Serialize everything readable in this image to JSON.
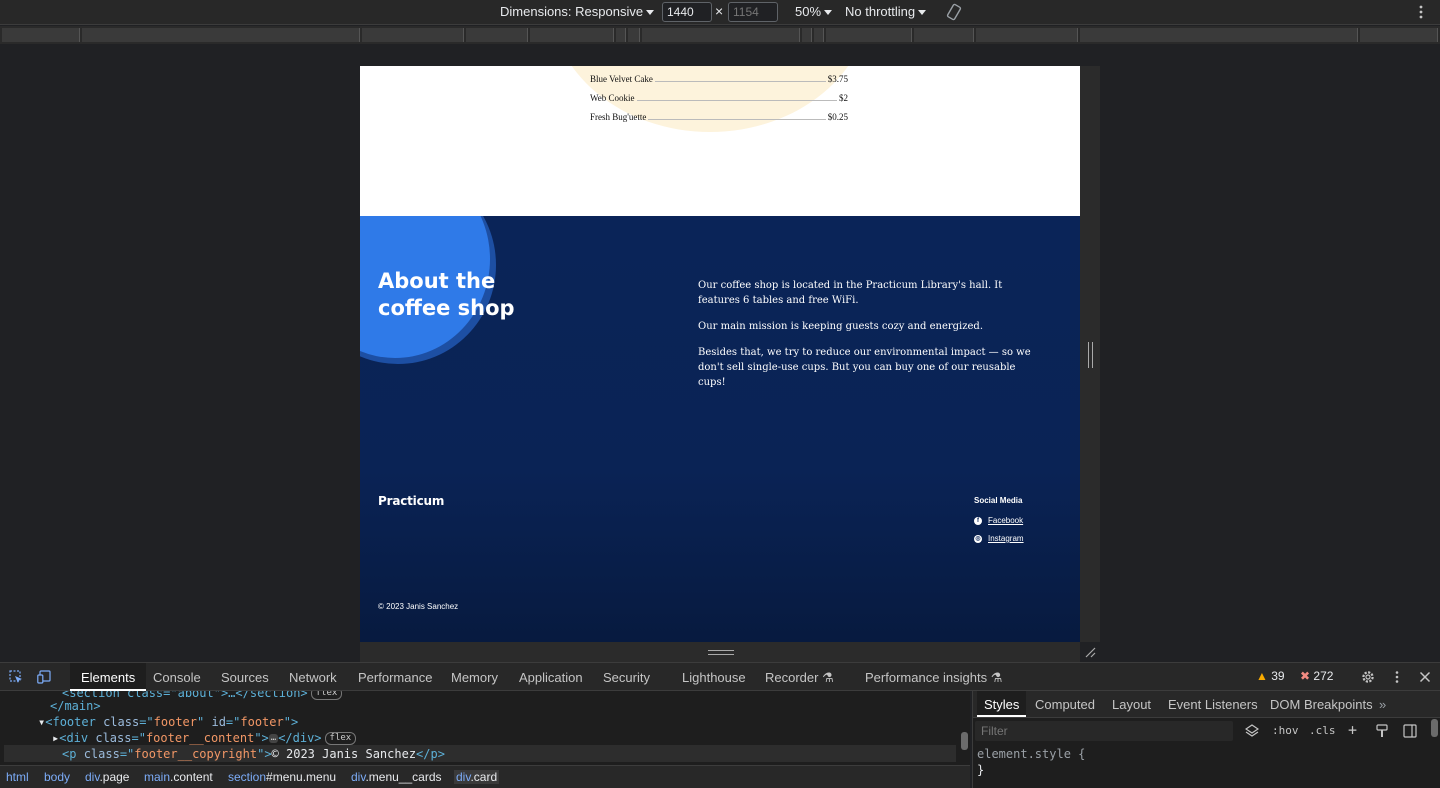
{
  "device_toolbar": {
    "dimensions_label": "Dimensions: Responsive",
    "width_value": "1440",
    "times": "×",
    "height_placeholder": "1154",
    "zoom": "50%",
    "throttling": "No throttling"
  },
  "page": {
    "menu_items": [
      {
        "name": "Blue Velvet Cake",
        "price": "$3.75"
      },
      {
        "name": "Web Cookie",
        "price": "$2"
      },
      {
        "name": "Fresh Bug'uette",
        "price": "$0.25"
      }
    ],
    "about": {
      "title": "About the coffee shop",
      "paragraphs": [
        "Our coffee shop is located in the Practicum Library's hall. It features 6 tables and free WiFi.",
        "Our main mission is keeping guests cozy and energized.",
        "Besides that, we try to reduce our environmental impact — so we don't sell single-use cups. But you can buy one of our reusable cups!"
      ]
    },
    "footer": {
      "logo": "Practicum",
      "social_title": "Social Media",
      "facebook": "Facebook",
      "instagram": "Instagram",
      "copyright": "© 2023 Janis Sanchez"
    }
  },
  "devtools": {
    "tabs": [
      "Elements",
      "Console",
      "Sources",
      "Network",
      "Performance",
      "Memory",
      "Application",
      "Security",
      "Lighthouse",
      "Recorder",
      "Performance insights"
    ],
    "warnings": "39",
    "errors": "272",
    "code": {
      "line0": "<section class=\"about\">…</section>",
      "main_close": "</main>",
      "footer_tag": "footer",
      "footer_class": "footer",
      "footer_id": "footer",
      "div_class": "footer__content",
      "p_class": "footer__copyright",
      "p_text": "© 2023 Janis Sanchez",
      "pill": "flex"
    },
    "breadcrumbs": [
      {
        "tag": "html",
        "rest": ""
      },
      {
        "tag": "body",
        "rest": ""
      },
      {
        "tag": "div",
        "rest": ".page"
      },
      {
        "tag": "main",
        "rest": ".content"
      },
      {
        "tag": "section",
        "rest": "#menu.menu"
      },
      {
        "tag": "div",
        "rest": ".menu__cards"
      },
      {
        "tag": "div",
        "rest": ".card"
      }
    ],
    "styles_tabs": [
      "Styles",
      "Computed",
      "Layout",
      "Event Listeners",
      "DOM Breakpoints"
    ],
    "filter_placeholder": "Filter",
    "hov": ":hov",
    "cls": ".cls",
    "rule_selector": "element.style {",
    "rule_close": "}"
  }
}
